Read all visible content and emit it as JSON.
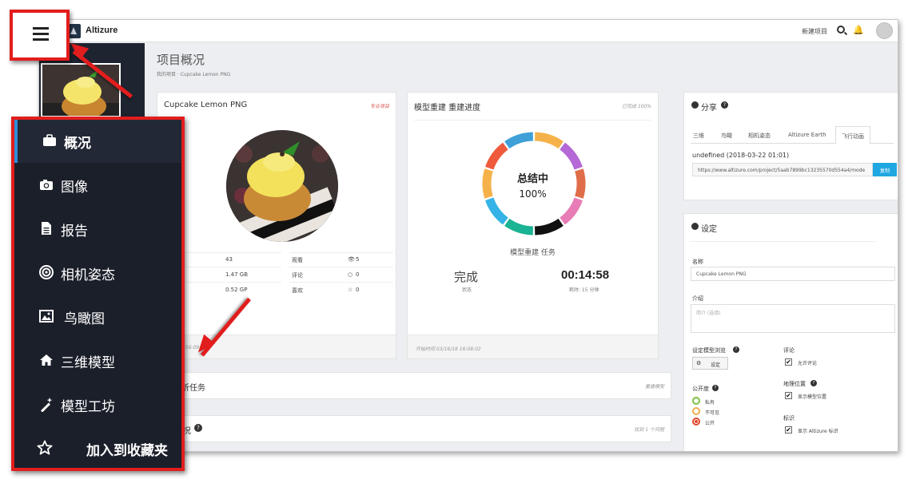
{
  "topbar": {
    "app_name": "Altizure",
    "new_project": "新建项目"
  },
  "page": {
    "title": "项目概况",
    "breadcrumb": "我的项目 · Cupcake Lemon PNG"
  },
  "project_card": {
    "title": "Cupcake Lemon PNG",
    "tag": "专业项目",
    "stats": [
      {
        "value": "43",
        "label": "观看",
        "count": "5"
      },
      {
        "value": "1.47 GB",
        "label": "评论",
        "count": "0"
      },
      {
        "value": "0.52 GP",
        "label": "喜欢",
        "count": "0"
      }
    ],
    "footer": "03/...15:56:09"
  },
  "progress_card": {
    "title": "模型重建 重建进度",
    "tag": "已完成 100%",
    "ring_status": "总结中",
    "ring_percent": "100%",
    "task_label": "模型重建 任务",
    "done_value": "完成",
    "done_sub": "状态",
    "time_value": "00:14:58",
    "time_sub": "耗时: 15 分钟",
    "footer": "开始时间 03/16/18 16:08:02",
    "ring_colors": [
      "#f6b24a",
      "#b469d6",
      "#e06d4a",
      "#e87cb6",
      "#111111",
      "#1ab394",
      "#35b3e6",
      "#f6b24a",
      "#ef5a3c",
      "#3fa0d8"
    ]
  },
  "tasks_card": {
    "title": "析任务",
    "tag": "重建模型"
  },
  "row2_card": {
    "title": "况",
    "tag": "找到 1 个问题"
  },
  "share_card": {
    "title": "分享",
    "tabs": [
      "三维",
      "鸟瞰",
      "相机姿态",
      "Altizure Earth",
      "飞行动画"
    ],
    "date": "undefined (2018-03-22 01:01)",
    "url": "https://www.altizure.com/project/5aab7899bc13235570d554a4/mode",
    "copy": "复制"
  },
  "settings_card": {
    "title": "设定",
    "name_label": "名称",
    "name_value": "Cupcake Lemon PNG",
    "intro_label": "介绍",
    "intro_placeholder": "简介 (选填)",
    "model_browse_label": "设定模型浏览",
    "model_browse_btn": "设定",
    "comment_label": "评论",
    "comment_opt": "允许评论",
    "geo_label": "地理位置",
    "geo_opt": "显示模型位置",
    "visibility_label": "公开度",
    "visibility_opts": [
      "私有",
      "不可见",
      "公开"
    ],
    "logo_label": "标识",
    "logo_opt": "显示 Altizure 标识"
  },
  "menu": {
    "items": [
      {
        "label": "概况",
        "icon": "briefcase-icon"
      },
      {
        "label": "图像",
        "icon": "camera-icon"
      },
      {
        "label": "报告",
        "icon": "document-icon"
      },
      {
        "label": "相机姿态",
        "icon": "target-icon"
      },
      {
        "label": "鸟瞰图",
        "icon": "image-icon"
      },
      {
        "label": "三维模型",
        "icon": "home-icon"
      },
      {
        "label": "模型工坊",
        "icon": "wand-icon"
      }
    ],
    "favorite": "加入到收藏夹"
  },
  "colors": {
    "annotation_red": "#e21d1d",
    "menu_bg": "#1b1f2a",
    "active_accent": "#2d8fd9",
    "copy_button": "#1fa7e1"
  }
}
